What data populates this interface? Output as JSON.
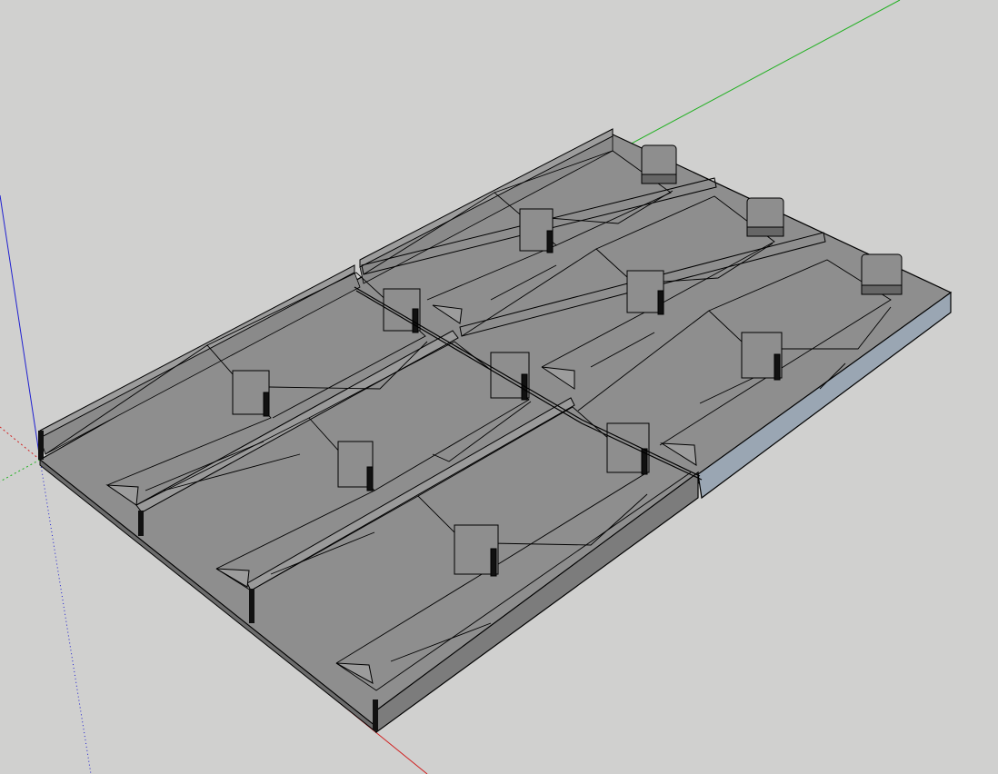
{
  "viewport": {
    "background_color": "#d0d0cf"
  },
  "axes": {
    "red_axis_color": "#d02020",
    "green_axis_color": "#20b020",
    "blue_axis_color": "#2020d0"
  },
  "model": {
    "tray_rows": 3,
    "tray_columns": 3,
    "face_color_top": "#8c8c8c",
    "face_color_side": "#7a7a7a",
    "face_color_end": "#9aa6b3",
    "edge_color": "#000000"
  }
}
